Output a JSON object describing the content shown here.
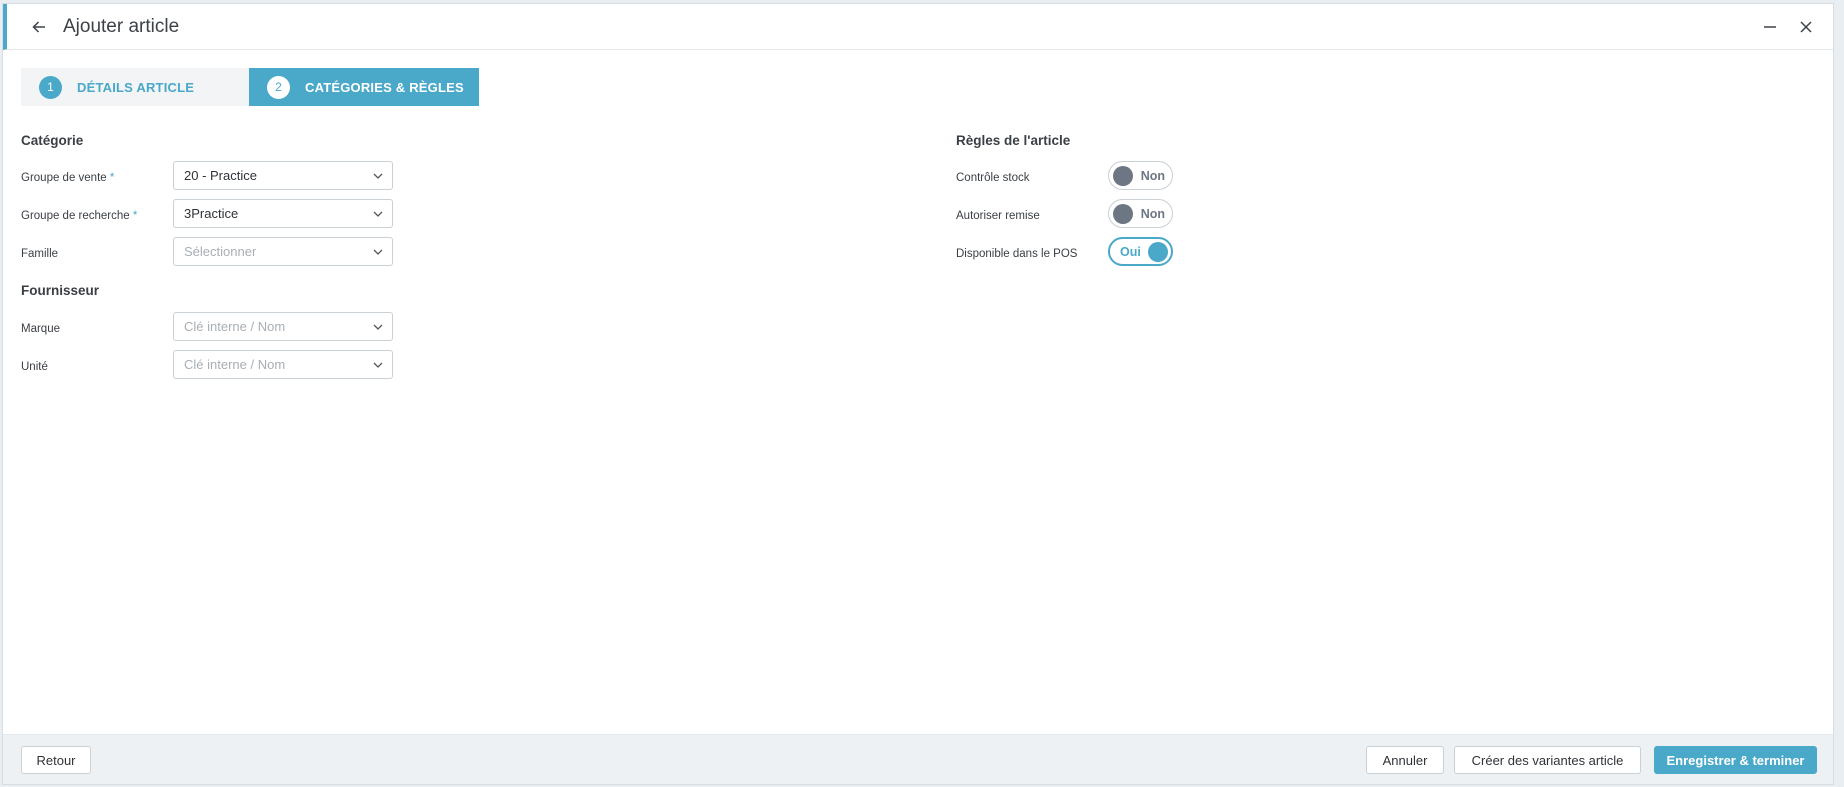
{
  "window": {
    "title": "Ajouter article"
  },
  "steps": [
    {
      "number": "1",
      "label": "DÉTAILS ARTICLE"
    },
    {
      "number": "2",
      "label": "CATÉGORIES & RÈGLES"
    }
  ],
  "category": {
    "title": "Catégorie",
    "groupe_vente": {
      "label": "Groupe de vente",
      "required": "*",
      "value": "20 - Practice"
    },
    "groupe_recherche": {
      "label": "Groupe de recherche",
      "required": "*",
      "value": "3Practice"
    },
    "famille": {
      "label": "Famille",
      "placeholder": "Sélectionner"
    }
  },
  "supplier": {
    "title": "Fournisseur",
    "marque": {
      "label": "Marque",
      "placeholder": "Clé interne / Nom"
    },
    "unite": {
      "label": "Unité",
      "placeholder": "Clé interne / Nom"
    }
  },
  "rules": {
    "title": "Règles de l'article",
    "items": [
      {
        "label": "Contrôle stock",
        "state": "Non"
      },
      {
        "label": "Autoriser remise",
        "state": "Non"
      },
      {
        "label": "Disponible dans le POS",
        "state": "Oui"
      }
    ]
  },
  "footer": {
    "back": "Retour",
    "cancel": "Annuler",
    "variants": "Créer des variantes article",
    "save": "Enregistrer & terminer"
  },
  "colors": {
    "accent": "#4aa8c8",
    "toggle_off": "#6d7683"
  },
  "icons": [
    "arrow-left-icon",
    "minimize-icon",
    "close-icon",
    "chevron-down-icon"
  ]
}
